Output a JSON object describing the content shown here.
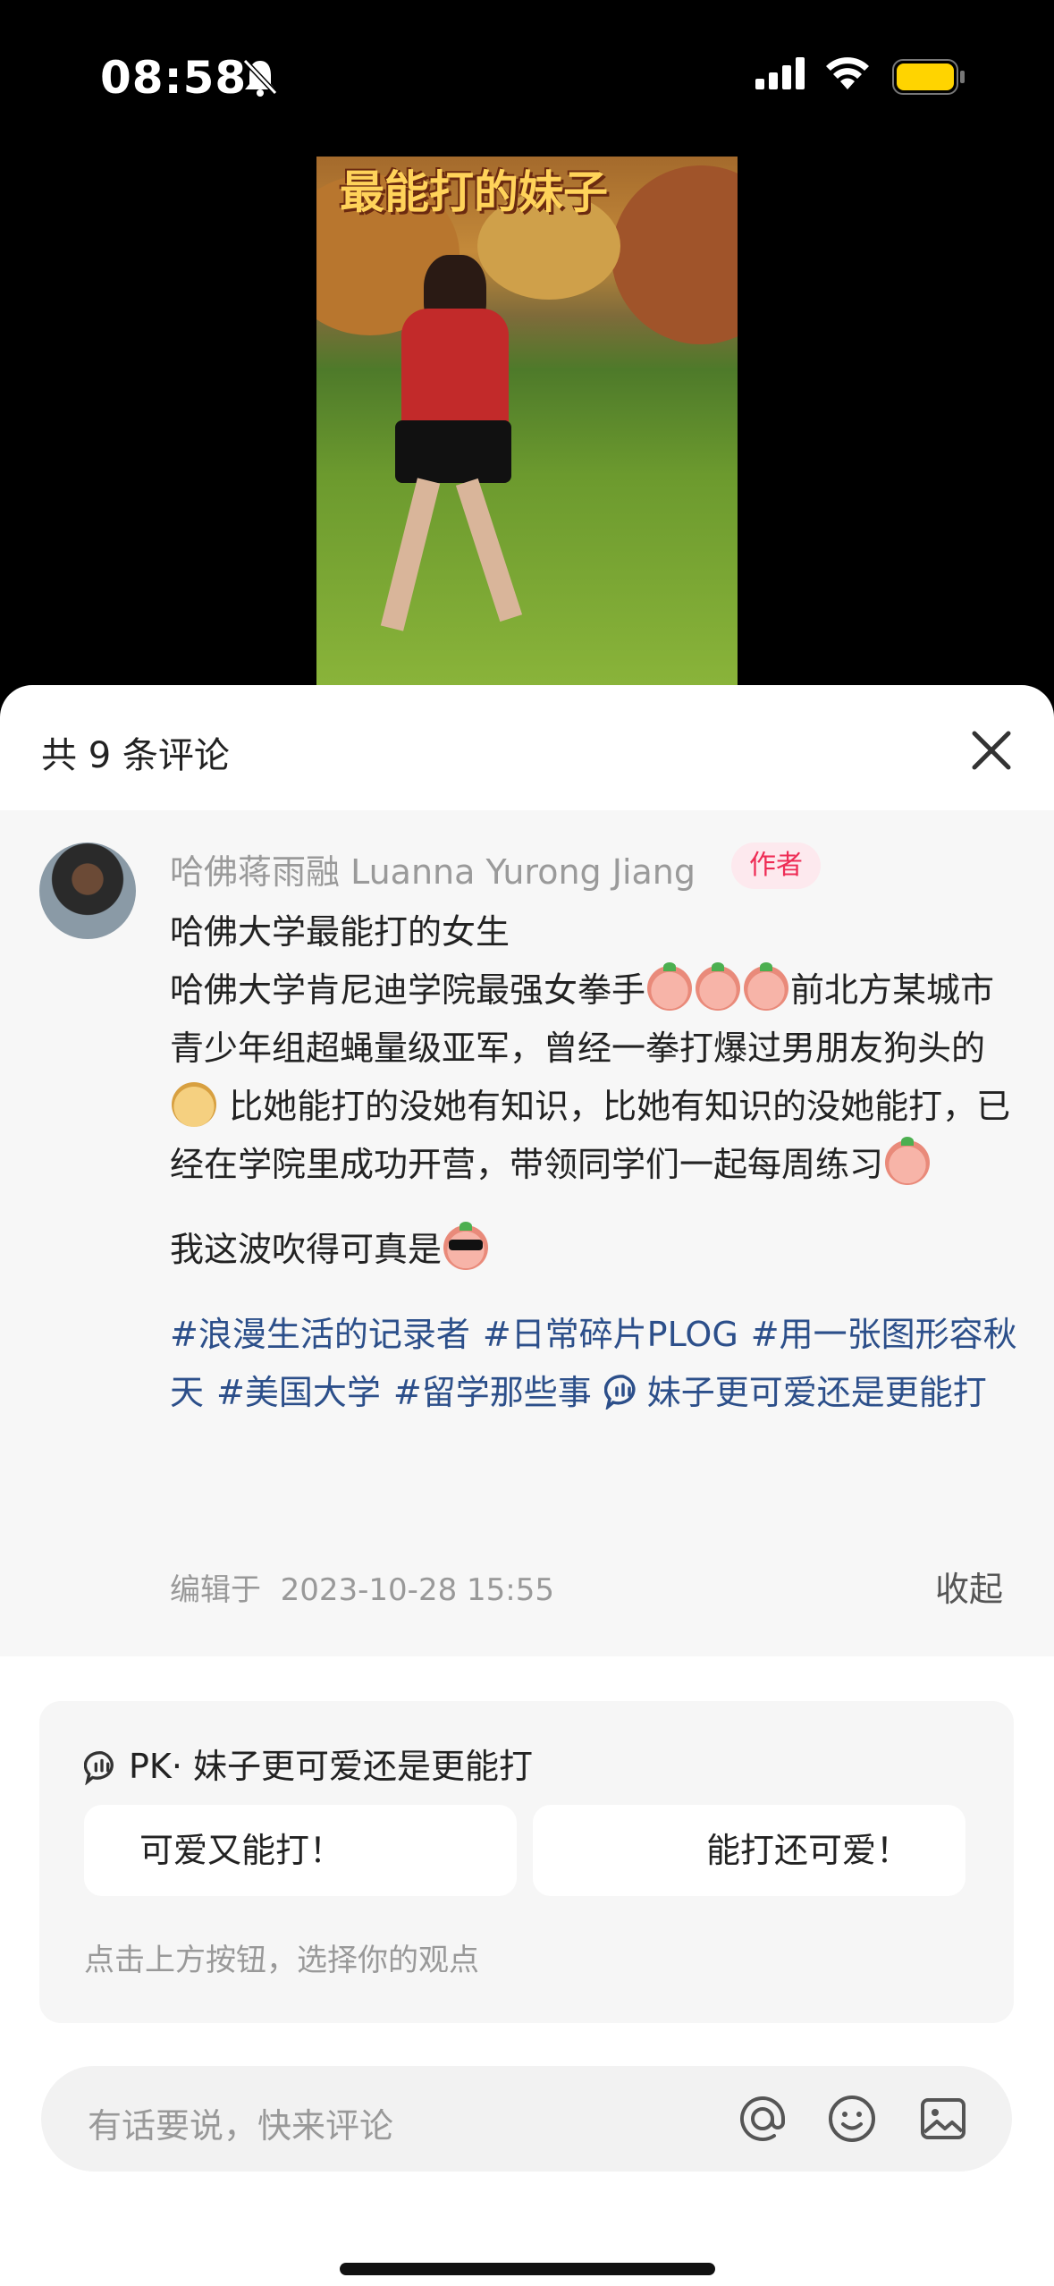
{
  "status_bar": {
    "time": "08:58",
    "icons": [
      "bell-slash-icon",
      "signal-icon",
      "wifi-icon",
      "battery-icon"
    ],
    "battery_color": "#FFD400"
  },
  "video": {
    "overlay_title": "最能打的妹子"
  },
  "comments_sheet": {
    "title": "共 9 条评论",
    "close_icon": "close-icon"
  },
  "post": {
    "author": "哈佛蒋雨融 Luanna Yurong Jiang",
    "author_badge": "作者",
    "line1": "哈佛大学最能打的女生",
    "para_a": "哈佛大学肯尼迪学院最强女拳手",
    "para_b": "前北方某城市青少年组超蝇量级亚军，曾经一拳打爆过男朋友狗头的",
    "para_c": " 比她能打的没她有知识，比她有知识的没她能打，已经在学院里成功开营，带领同学们一起每周练习",
    "line3": "我这波吹得可真是",
    "tags": [
      "#浪漫生活的记录者",
      "#日常碎片PLOG",
      "#用一张图形容秋天",
      "#美国大学",
      "#留学那些事"
    ],
    "poll_tag": "妹子更可爱还是更能打",
    "edit_label": "编辑于",
    "edit_time": "2023-10-28 15:55",
    "collapse": "收起",
    "accent_color": "#2C4F8A",
    "badge_color": "#EE2C55"
  },
  "pk": {
    "title": "PK· 妹子更可爱还是更能打",
    "option_left": "可爱又能打！",
    "option_right": "能打还可爱！",
    "hint": "点击上方按钮，选择你的观点"
  },
  "input": {
    "placeholder": "有话要说，快来评论",
    "icons": [
      "at-icon",
      "emoji-icon",
      "image-icon"
    ]
  }
}
